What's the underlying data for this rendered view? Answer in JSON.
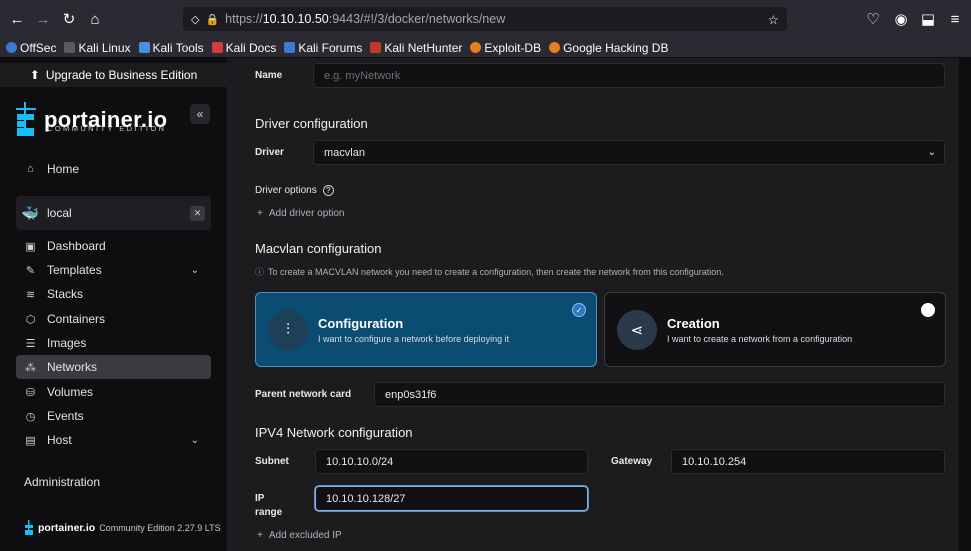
{
  "browser": {
    "url_prefix": "https://",
    "url_host": "10.10.10.50",
    "url_rest": ":9443/#!/3/docker/networks/new",
    "bookmarks": [
      "OffSec",
      "Kali Linux",
      "Kali Tools",
      "Kali Docs",
      "Kali Forums",
      "Kali NetHunter",
      "Exploit-DB",
      "Google Hacking DB"
    ]
  },
  "sidebar": {
    "upgrade_label": "Upgrade to Business Edition",
    "logo_text": "portainer.io",
    "logo_sub": "COMMUNITY EDITION",
    "home": "Home",
    "environment": "local",
    "items": [
      "Dashboard",
      "Templates",
      "Stacks",
      "Containers",
      "Images",
      "Networks",
      "Volumes",
      "Events",
      "Host"
    ],
    "administration": "Administration",
    "footer_brand": "portainer.io",
    "footer_edition": "Community Edition 2.27.9 LTS"
  },
  "form": {
    "name_label": "Name",
    "name_placeholder": "e.g. myNetwork",
    "driver_section": "Driver configuration",
    "driver_label": "Driver",
    "driver_value": "macvlan",
    "driver_options": "Driver options",
    "add_driver_option": "Add driver option",
    "macvlan_section": "Macvlan configuration",
    "macvlan_info": "To create a MACVLAN network you need to create a configuration, then create the network from this configuration.",
    "config_title": "Configuration",
    "config_desc": "I want to configure a network before deploying it",
    "creation_title": "Creation",
    "creation_desc": "I want to create a network from a configuration",
    "parent_label": "Parent network card",
    "parent_value": "enp0s31f6",
    "ipv4_section": "IPV4 Network configuration",
    "subnet_label": "Subnet",
    "subnet_value": "10.10.10.0/24",
    "gateway_label": "Gateway",
    "gateway_value": "10.10.10.254",
    "ip_label": "IP",
    "range_label": "range",
    "ip_range_value": "10.10.10.128/27",
    "add_excluded_ip": "Add excluded IP"
  },
  "colors": {
    "accent": "#0b4d72",
    "sidebar_bg": "#0e0e10",
    "main_bg": "#1c1c1f"
  }
}
